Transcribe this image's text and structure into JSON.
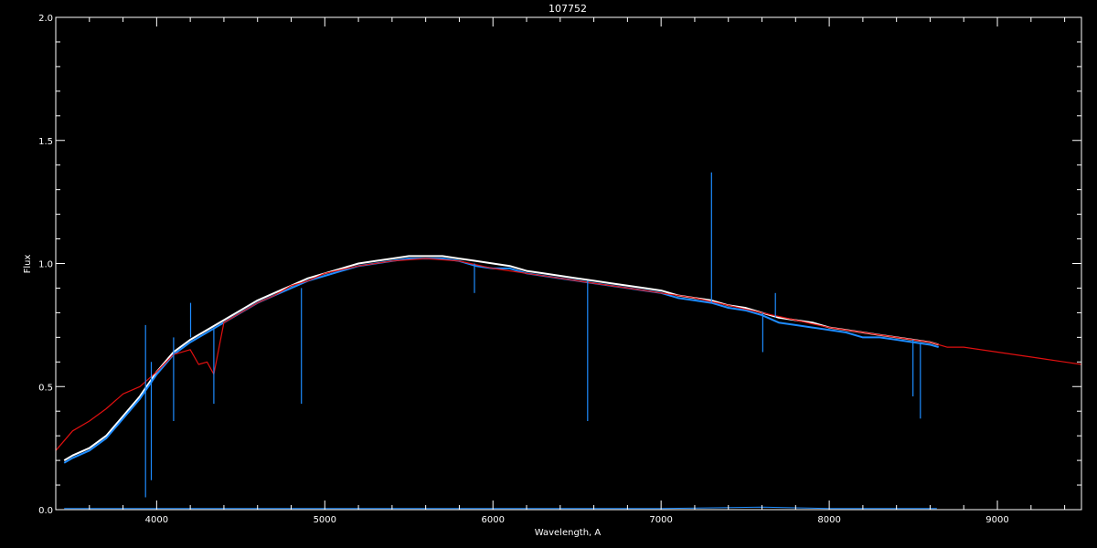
{
  "chart_data": {
    "type": "line",
    "title": "107752",
    "xlabel": "Wavelength, A",
    "ylabel": "Flux",
    "xlim": [
      3400,
      9500
    ],
    "ylim": [
      0.0,
      2.0
    ],
    "x_ticks": [
      "4000",
      "5000",
      "6000",
      "7000",
      "8000",
      "9000"
    ],
    "y_ticks": [
      "0.0",
      "0.5",
      "1.0",
      "1.5",
      "2.0"
    ],
    "grid": false,
    "legend": "none",
    "colors": {
      "background": "#000000",
      "axes": "#ffffff",
      "observed_white": "#ffffff",
      "observed_blue": "#1e8cff",
      "model_red": "#e01010"
    },
    "series": [
      {
        "color": "#ffffff",
        "x": [
          3450,
          3500,
          3600,
          3700,
          3800,
          3900,
          4000,
          4100,
          4200,
          4300,
          4400,
          4500,
          4600,
          4700,
          4800,
          4900,
          5000,
          5100,
          5200,
          5300,
          5400,
          5500,
          5600,
          5700,
          5800,
          5900,
          6000,
          6100,
          6200,
          6300,
          6400,
          6500,
          6600,
          6700,
          6800,
          6900,
          7000,
          7100,
          7200,
          7300,
          7400,
          7500,
          7600,
          7700,
          7800,
          7900,
          8000,
          8100,
          8200,
          8300,
          8400,
          8500,
          8600,
          8650
        ],
        "y": [
          0.2,
          0.22,
          0.25,
          0.3,
          0.38,
          0.46,
          0.56,
          0.64,
          0.69,
          0.73,
          0.77,
          0.81,
          0.85,
          0.88,
          0.91,
          0.94,
          0.96,
          0.98,
          1.0,
          1.01,
          1.02,
          1.03,
          1.03,
          1.03,
          1.02,
          1.01,
          1.0,
          0.99,
          0.97,
          0.96,
          0.95,
          0.94,
          0.93,
          0.92,
          0.91,
          0.9,
          0.89,
          0.87,
          0.86,
          0.85,
          0.83,
          0.82,
          0.8,
          0.78,
          0.77,
          0.76,
          0.74,
          0.73,
          0.72,
          0.71,
          0.7,
          0.69,
          0.68,
          0.67
        ]
      },
      {
        "color": "#1e8cff",
        "x": [
          3450,
          3500,
          3600,
          3700,
          3800,
          3900,
          4000,
          4100,
          4200,
          4300,
          4400,
          4500,
          4600,
          4700,
          4800,
          4900,
          5000,
          5100,
          5200,
          5300,
          5400,
          5500,
          5600,
          5700,
          5800,
          5900,
          6000,
          6100,
          6200,
          6300,
          6400,
          6500,
          6600,
          6700,
          6800,
          6900,
          7000,
          7100,
          7200,
          7300,
          7400,
          7500,
          7600,
          7700,
          7800,
          7900,
          8000,
          8100,
          8200,
          8300,
          8400,
          8500,
          8600,
          8650
        ],
        "y": [
          0.19,
          0.21,
          0.24,
          0.29,
          0.37,
          0.45,
          0.55,
          0.63,
          0.68,
          0.72,
          0.76,
          0.8,
          0.84,
          0.87,
          0.9,
          0.93,
          0.95,
          0.97,
          0.99,
          1.0,
          1.01,
          1.02,
          1.02,
          1.02,
          1.01,
          0.99,
          0.98,
          0.98,
          0.96,
          0.95,
          0.94,
          0.93,
          0.92,
          0.91,
          0.9,
          0.89,
          0.88,
          0.86,
          0.85,
          0.84,
          0.82,
          0.81,
          0.79,
          0.76,
          0.75,
          0.74,
          0.73,
          0.72,
          0.7,
          0.7,
          0.69,
          0.68,
          0.67,
          0.66
        ]
      },
      {
        "color": "#e01010",
        "x": [
          3400,
          3500,
          3600,
          3700,
          3800,
          3900,
          3950,
          4000,
          4100,
          4200,
          4250,
          4300,
          4340,
          4400,
          4500,
          4600,
          4700,
          4800,
          4900,
          5000,
          5200,
          5400,
          5600,
          5800,
          6000,
          6200,
          6400,
          6600,
          6800,
          7000,
          7200,
          7400,
          7600,
          7800,
          8000,
          8200,
          8400,
          8600,
          8700,
          8800,
          9000,
          9200,
          9400,
          9500
        ],
        "y": [
          0.24,
          0.32,
          0.36,
          0.41,
          0.47,
          0.5,
          0.53,
          0.56,
          0.63,
          0.65,
          0.59,
          0.6,
          0.55,
          0.76,
          0.8,
          0.84,
          0.87,
          0.91,
          0.93,
          0.96,
          0.99,
          1.01,
          1.02,
          1.01,
          0.98,
          0.96,
          0.94,
          0.92,
          0.9,
          0.88,
          0.86,
          0.83,
          0.8,
          0.77,
          0.74,
          0.72,
          0.7,
          0.68,
          0.66,
          0.66,
          0.64,
          0.62,
          0.6,
          0.59
        ]
      },
      {
        "color": "#1e8cff",
        "x": [
          3450,
          4000,
          5000,
          6000,
          7000,
          7600,
          8000,
          8640
        ],
        "y": [
          0.005,
          0.005,
          0.005,
          0.005,
          0.005,
          0.01,
          0.005,
          0.005
        ]
      }
    ],
    "features": [
      {
        "color": "#1e8cff",
        "x": 3934,
        "y": [
          0.75,
          0.05
        ]
      },
      {
        "color": "#1e8cff",
        "x": 3968,
        "y": [
          0.6,
          0.12
        ]
      },
      {
        "color": "#1e8cff",
        "x": 4101,
        "y": [
          0.7,
          0.36
        ]
      },
      {
        "color": "#1e8cff",
        "x": 4202,
        "y": [
          0.7,
          0.84
        ]
      },
      {
        "color": "#1e8cff",
        "x": 4340,
        "y": [
          0.74,
          0.43
        ]
      },
      {
        "color": "#1e8cff",
        "x": 4861,
        "y": [
          0.9,
          0.43
        ]
      },
      {
        "color": "#1e8cff",
        "x": 5890,
        "y": [
          1.0,
          0.88
        ]
      },
      {
        "color": "#1e8cff",
        "x": 6563,
        "y": [
          0.93,
          0.36
        ]
      },
      {
        "color": "#1e8cff",
        "x": 7300,
        "y": [
          0.84,
          1.37
        ]
      },
      {
        "color": "#1e8cff",
        "x": 7605,
        "y": [
          0.8,
          0.64
        ]
      },
      {
        "color": "#1e8cff",
        "x": 7680,
        "y": [
          0.78,
          0.88
        ]
      },
      {
        "color": "#1e8cff",
        "x": 8498,
        "y": [
          0.69,
          0.46
        ]
      },
      {
        "color": "#1e8cff",
        "x": 8542,
        "y": [
          0.68,
          0.37
        ]
      }
    ]
  }
}
